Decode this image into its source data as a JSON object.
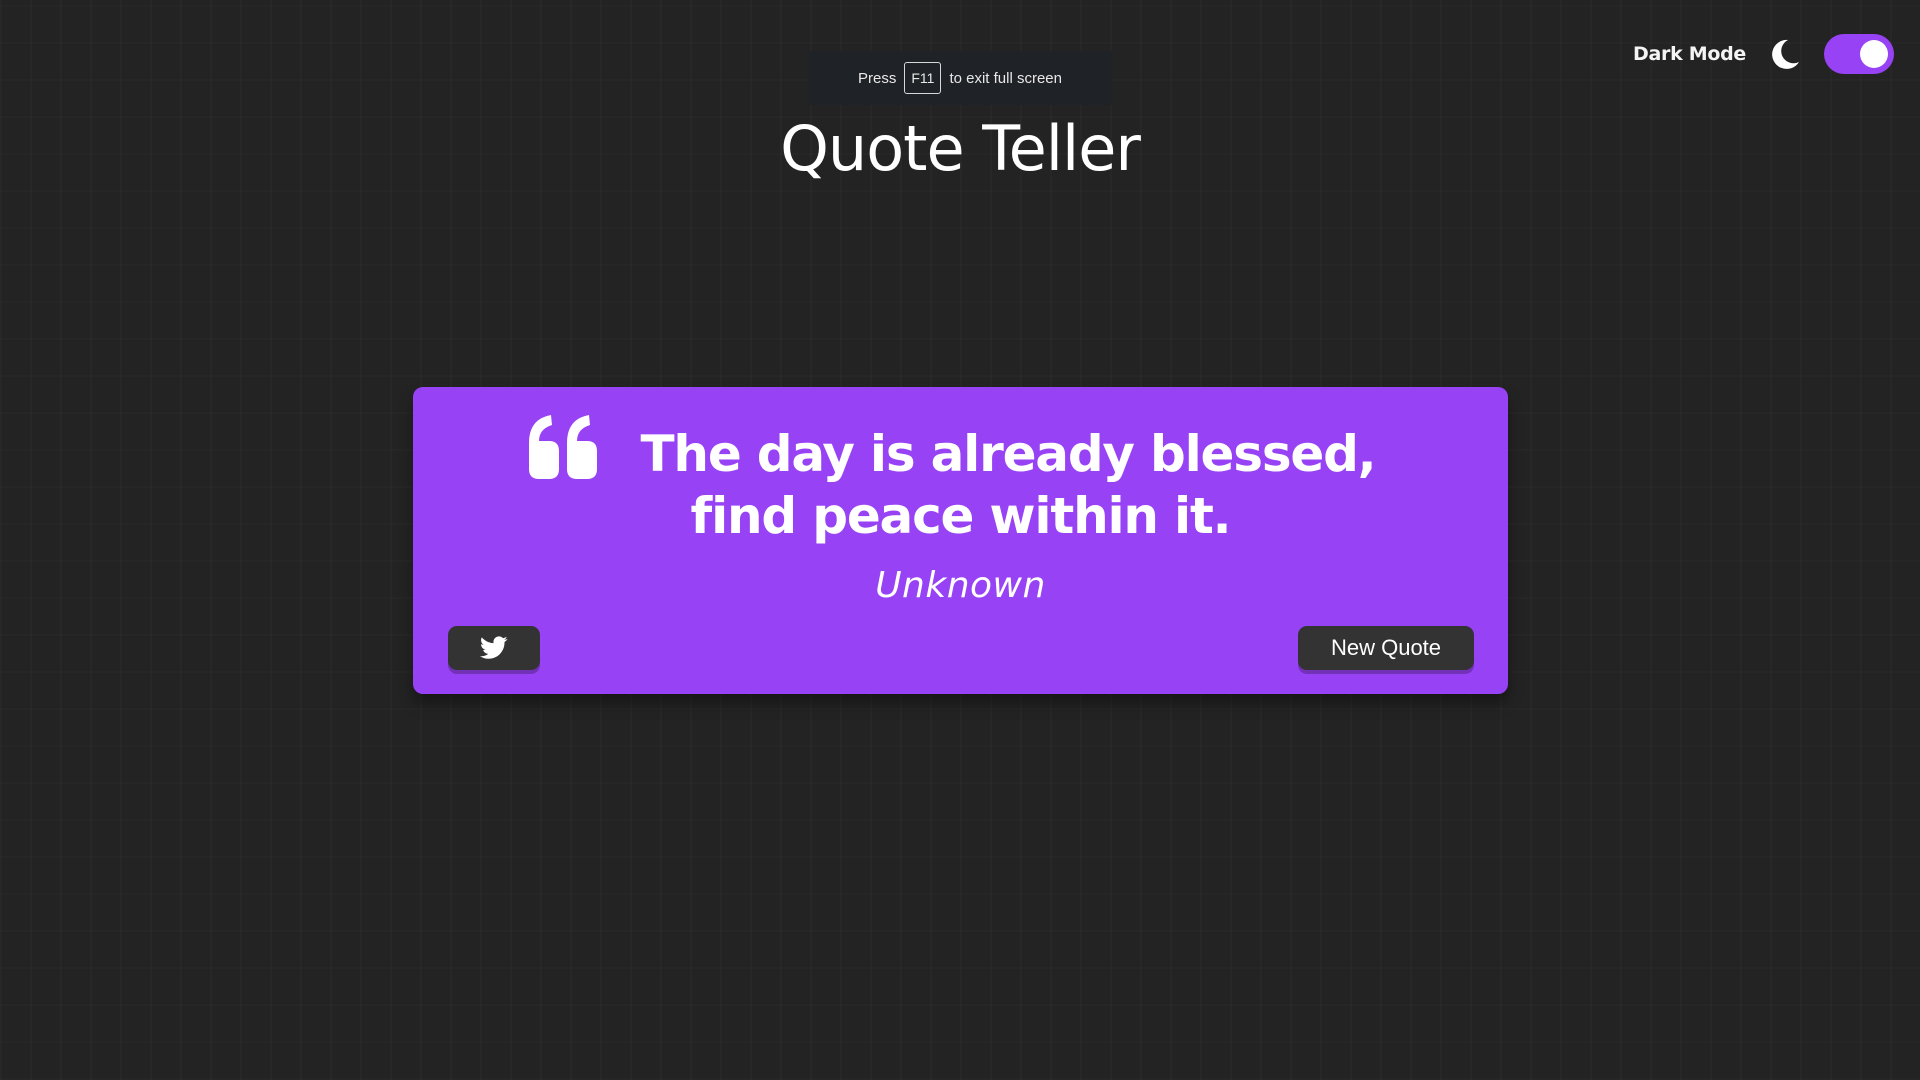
{
  "fullscreen_hint": {
    "before": "Press",
    "key": "F11",
    "after": "to exit full screen"
  },
  "theme": {
    "label": "Dark Mode",
    "icon": "moon-icon",
    "toggle_on": true,
    "accent_color": "#9842f5"
  },
  "header": {
    "title": "Quote Teller"
  },
  "quote": {
    "text": "The day is already blessed, find peace within it.",
    "author": "Unknown",
    "icon": "quote-left-icon",
    "card_color": "#9842f5"
  },
  "actions": {
    "tweet_icon": "twitter-icon",
    "new_quote_label": "New Quote"
  }
}
